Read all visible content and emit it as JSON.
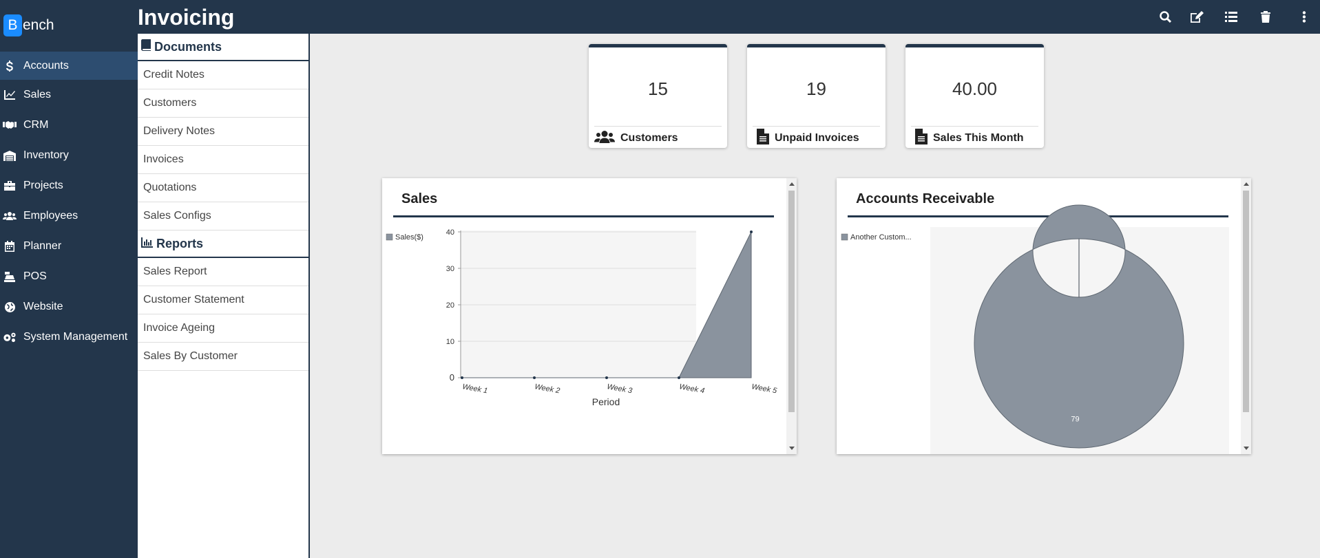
{
  "brand": {
    "initial": "B",
    "rest": "ench"
  },
  "nav": [
    {
      "label": "Accounts",
      "icon": "dollar-icon",
      "active": true
    },
    {
      "label": "Sales",
      "icon": "chart-line-icon"
    },
    {
      "label": "CRM",
      "icon": "handshake-icon"
    },
    {
      "label": "Inventory",
      "icon": "warehouse-icon"
    },
    {
      "label": "Projects",
      "icon": "briefcase-icon"
    },
    {
      "label": "Employees",
      "icon": "users-icon"
    },
    {
      "label": "Planner",
      "icon": "calendar-icon"
    },
    {
      "label": "POS",
      "icon": "cash-register-icon"
    },
    {
      "label": "Website",
      "icon": "globe-icon"
    },
    {
      "label": "System Management",
      "icon": "cogs-icon"
    }
  ],
  "page_title": "Invoicing",
  "toolbar": [
    "search-icon",
    "edit-icon",
    "list-icon",
    "trash-icon",
    "more-vertical-icon"
  ],
  "documents": {
    "header": "Documents",
    "items": [
      "Credit Notes",
      "Customers",
      "Delivery Notes",
      "Invoices",
      "Quotations",
      "Sales Configs"
    ]
  },
  "reports": {
    "header": "Reports",
    "items": [
      "Sales Report",
      "Customer Statement",
      "Invoice Ageing",
      "Sales By Customer"
    ]
  },
  "cards": [
    {
      "value": "15",
      "label": "Customers",
      "icon": "users-icon"
    },
    {
      "value": "19",
      "label": "Unpaid Invoices",
      "icon": "file-icon"
    },
    {
      "value": "40.00",
      "label": "Sales This Month",
      "icon": "file-icon"
    }
  ],
  "colors": {
    "primary": "#23364b",
    "active_nav": "#2d4d70",
    "brand": "#1a8cff",
    "series": "#8a939e"
  },
  "sales_panel": {
    "title": "Sales"
  },
  "ar_panel": {
    "title": "Accounts Receivable"
  },
  "chart_data": [
    {
      "type": "area",
      "title": "Sales",
      "categories": [
        "Week 1",
        "Week 2",
        "Week 3",
        "Week 4",
        "Week 5"
      ],
      "series": [
        {
          "name": "Sales($)",
          "values": [
            0,
            0,
            0,
            0,
            40
          ]
        }
      ],
      "xlabel": "Period",
      "ylabel": "",
      "ylim": [
        0,
        40
      ],
      "yticks": [
        0,
        10,
        20,
        30,
        40
      ],
      "grid": true,
      "legend": "top-left"
    },
    {
      "type": "pie",
      "title": "Accounts Receivable",
      "donut": true,
      "labels": [
        "Another Custom..."
      ],
      "values": [
        79
      ],
      "legend": "top-left"
    }
  ]
}
